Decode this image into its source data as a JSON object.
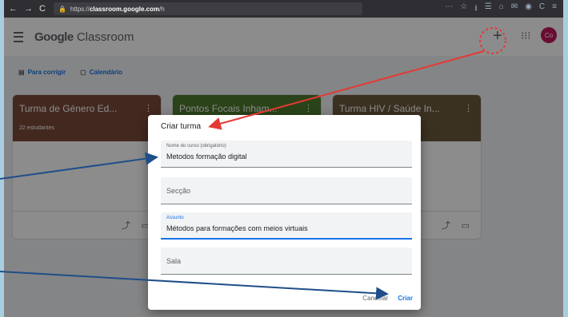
{
  "browser": {
    "url_prefix": "https://",
    "url_host": "classroom.google.com",
    "url_path": "/h",
    "nav_back": "←",
    "nav_forward": "→",
    "nav_reload": "C",
    "icons": [
      "⋯",
      "☆",
      "⭳",
      "☰",
      "⌂",
      "✉",
      "◉",
      "C",
      "≡"
    ]
  },
  "app": {
    "brand_google": "Google",
    "brand_product": " Classroom",
    "plus": "+",
    "apps_icon": "⁝⁝⁝",
    "avatar": "Co"
  },
  "shortcuts": [
    {
      "label": "Para corrigir",
      "icon": "▤"
    },
    {
      "label": "Calendário",
      "icon": "▢"
    }
  ],
  "cards": [
    {
      "title": "Turma de Género Ed...",
      "sub": "22 estudantes",
      "color": "#7a4a3a"
    },
    {
      "title": "Pontos Focais Inham...",
      "sub": "",
      "color": "#4e7a2c"
    },
    {
      "title": "Turma HIV / Saúde In...",
      "sub": "",
      "color": "#6c5a3c"
    }
  ],
  "dialog": {
    "title": "Criar turma",
    "fields": [
      {
        "label": "Nome do curso (obrigatório)",
        "value": "Metodos formação digital"
      },
      {
        "placeholder": "Secção"
      },
      {
        "label": "Assunto",
        "value": "Métodos para formações com meios virtuais"
      },
      {
        "placeholder": "Sala"
      }
    ],
    "cancel": "Cancelar",
    "create": "Criar"
  },
  "annotation_color_red": "#e53935",
  "annotation_color_blue": "#1f4e89"
}
